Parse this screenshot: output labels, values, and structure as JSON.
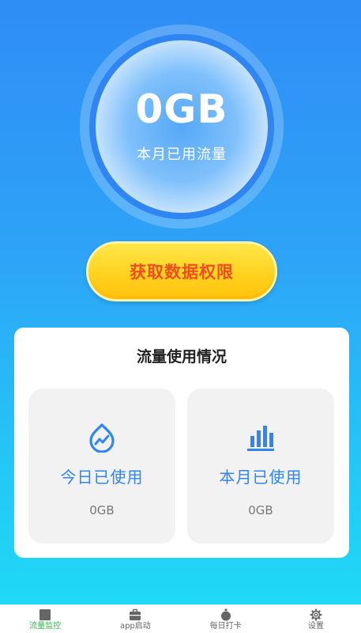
{
  "dial": {
    "value": "0GB",
    "label": "本月已用流量"
  },
  "permission_button": {
    "label": "获取数据权限"
  },
  "usage": {
    "title": "流量使用情况",
    "today": {
      "label": "今日已使用",
      "value": "0GB",
      "icon": "chart-drop-icon"
    },
    "month": {
      "label": "本月已使用",
      "value": "0GB",
      "icon": "bar-chart-icon"
    }
  },
  "nav": {
    "items": [
      {
        "label": "流量监控",
        "icon": "square-icon",
        "active": true
      },
      {
        "label": "app启动",
        "icon": "briefcase-icon",
        "active": false
      },
      {
        "label": "每日打卡",
        "icon": "egg-icon",
        "active": false
      },
      {
        "label": "设置",
        "icon": "gear-icon",
        "active": false
      }
    ]
  },
  "colors": {
    "accent": "#2f86f3",
    "button_text": "#f04d1f",
    "button_fill": "#ffd21f",
    "nav_active": "#2fb34a"
  }
}
